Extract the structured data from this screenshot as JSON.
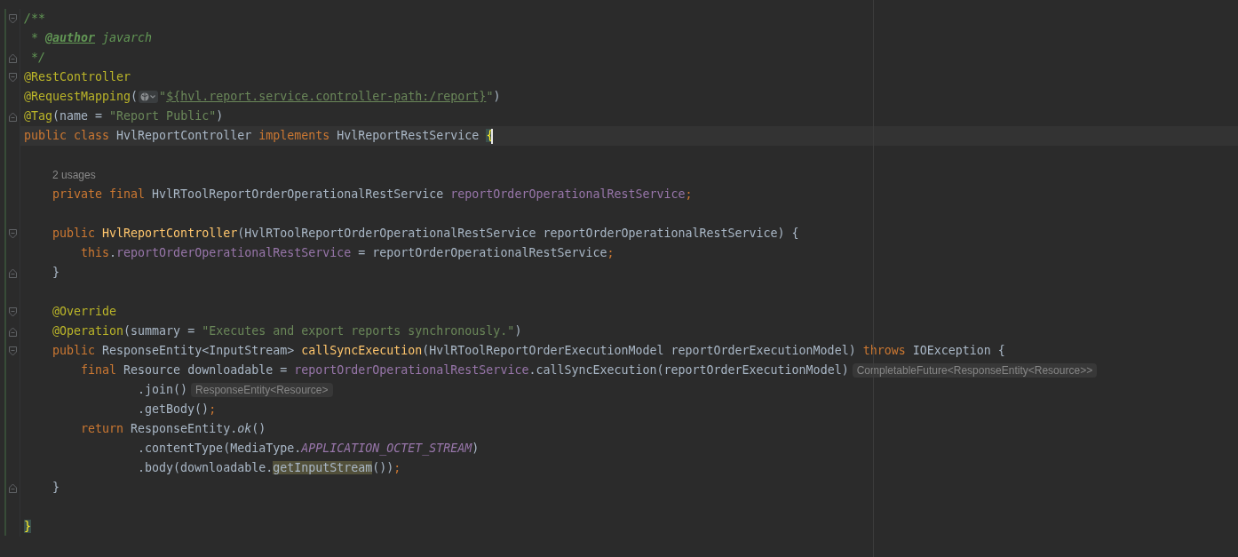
{
  "editor": {
    "lines": [
      {
        "current": false,
        "kind": "fold-start",
        "tokens": [
          {
            "kind": "comment",
            "text": "/**"
          }
        ]
      },
      {
        "current": false,
        "kind": "code",
        "tokens": [
          {
            "kind": "comment",
            "text": " * "
          },
          {
            "kind": "doc-tag",
            "text": "@author"
          },
          {
            "kind": "comment",
            "text": " javarch"
          }
        ]
      },
      {
        "current": false,
        "kind": "fold-end",
        "tokens": [
          {
            "kind": "comment",
            "text": " */"
          }
        ]
      },
      {
        "current": false,
        "kind": "fold-start",
        "tokens": [
          {
            "kind": "annotation",
            "text": "@RestController"
          }
        ]
      },
      {
        "current": false,
        "kind": "code",
        "tokens": [
          {
            "kind": "annotation",
            "text": "@RequestMapping"
          },
          {
            "kind": "plain",
            "text": "("
          },
          {
            "kind": "url-inlay"
          },
          {
            "kind": "string",
            "text": "\""
          },
          {
            "kind": "link-string",
            "text": "${hvl.report.service.controller-path:/report}"
          },
          {
            "kind": "string",
            "text": "\""
          },
          {
            "kind": "plain",
            "text": ")"
          }
        ]
      },
      {
        "current": false,
        "kind": "fold-end",
        "tokens": [
          {
            "kind": "annotation",
            "text": "@Tag"
          },
          {
            "kind": "plain",
            "text": "(name = "
          },
          {
            "kind": "string",
            "text": "\"Report Public\""
          },
          {
            "kind": "plain",
            "text": ")"
          }
        ]
      },
      {
        "current": true,
        "kind": "code",
        "tokens": [
          {
            "kind": "keyword",
            "text": "public class "
          },
          {
            "kind": "plain",
            "text": "HvlReportController "
          },
          {
            "kind": "keyword",
            "text": "implements "
          },
          {
            "kind": "plain",
            "text": "HvlReportRestService "
          },
          {
            "kind": "brace-match",
            "text": "{"
          }
        ]
      },
      {
        "current": false,
        "kind": "code"
      },
      {
        "current": false,
        "kind": "code",
        "tokens": [
          {
            "kind": "indent"
          },
          {
            "kind": "usages-hint",
            "text": "2 usages"
          }
        ]
      },
      {
        "current": false,
        "kind": "code",
        "tokens": [
          {
            "kind": "indent"
          },
          {
            "kind": "keyword",
            "text": "private final "
          },
          {
            "kind": "plain",
            "text": "HvlRToolReportOrderOperationalRestService "
          },
          {
            "kind": "field",
            "text": "reportOrderOperationalRestService"
          },
          {
            "kind": "keyword",
            "text": ";"
          }
        ]
      },
      {
        "current": false,
        "kind": "code"
      },
      {
        "current": false,
        "kind": "fold-start",
        "tokens": [
          {
            "kind": "indent"
          },
          {
            "kind": "keyword",
            "text": "public "
          },
          {
            "kind": "method-decl",
            "text": "HvlReportController"
          },
          {
            "kind": "plain",
            "text": "(HvlRToolReportOrderOperationalRestService reportOrderOperationalRestService) {"
          }
        ]
      },
      {
        "current": false,
        "kind": "code",
        "tokens": [
          {
            "kind": "indent"
          },
          {
            "kind": "indent"
          },
          {
            "kind": "keyword",
            "text": "this"
          },
          {
            "kind": "plain",
            "text": "."
          },
          {
            "kind": "field",
            "text": "reportOrderOperationalRestService"
          },
          {
            "kind": "plain",
            "text": " = reportOrderOperationalRestService"
          },
          {
            "kind": "keyword",
            "text": ";"
          }
        ]
      },
      {
        "current": false,
        "kind": "fold-end",
        "tokens": [
          {
            "kind": "indent"
          },
          {
            "kind": "plain",
            "text": "}"
          }
        ]
      },
      {
        "current": false,
        "kind": "code"
      },
      {
        "current": false,
        "kind": "fold-start",
        "tokens": [
          {
            "kind": "indent"
          },
          {
            "kind": "annotation",
            "text": "@Override"
          }
        ]
      },
      {
        "current": false,
        "kind": "fold-end",
        "tokens": [
          {
            "kind": "indent"
          },
          {
            "kind": "annotation",
            "text": "@Operation"
          },
          {
            "kind": "plain",
            "text": "(summary = "
          },
          {
            "kind": "string",
            "text": "\"Executes and export reports synchronously.\""
          },
          {
            "kind": "plain",
            "text": ")"
          }
        ]
      },
      {
        "current": false,
        "kind": "fold-start",
        "tokens": [
          {
            "kind": "indent"
          },
          {
            "kind": "keyword",
            "text": "public "
          },
          {
            "kind": "plain",
            "text": "ResponseEntity<InputStream> "
          },
          {
            "kind": "method-decl",
            "text": "callSyncExecution"
          },
          {
            "kind": "plain",
            "text": "(HvlRToolReportOrderExecutionModel reportOrderExecutionModel) "
          },
          {
            "kind": "keyword",
            "text": "throws "
          },
          {
            "kind": "plain",
            "text": "IOException {"
          }
        ]
      },
      {
        "current": false,
        "kind": "code",
        "tokens": [
          {
            "kind": "indent"
          },
          {
            "kind": "indent"
          },
          {
            "kind": "keyword",
            "text": "final "
          },
          {
            "kind": "plain",
            "text": "Resource downloadable = "
          },
          {
            "kind": "field",
            "text": "reportOrderOperationalRestService"
          },
          {
            "kind": "plain",
            "text": ".callSyncExecution(reportOrderExecutionModel)"
          },
          {
            "kind": "type-hint",
            "text": "CompletableFuture<ResponseEntity<Resource>>"
          }
        ]
      },
      {
        "current": false,
        "kind": "code",
        "tokens": [
          {
            "kind": "indent"
          },
          {
            "kind": "indent"
          },
          {
            "kind": "indent"
          },
          {
            "kind": "indent"
          },
          {
            "kind": "plain",
            "text": ".join()"
          },
          {
            "kind": "type-hint",
            "text": "ResponseEntity<Resource>"
          }
        ]
      },
      {
        "current": false,
        "kind": "code",
        "tokens": [
          {
            "kind": "indent"
          },
          {
            "kind": "indent"
          },
          {
            "kind": "indent"
          },
          {
            "kind": "indent"
          },
          {
            "kind": "plain",
            "text": ".getBody()"
          },
          {
            "kind": "keyword",
            "text": ";"
          }
        ]
      },
      {
        "current": false,
        "kind": "code",
        "tokens": [
          {
            "kind": "indent"
          },
          {
            "kind": "indent"
          },
          {
            "kind": "keyword",
            "text": "return "
          },
          {
            "kind": "plain",
            "text": "ResponseEntity."
          },
          {
            "kind": "static-method",
            "text": "ok"
          },
          {
            "kind": "plain",
            "text": "()"
          }
        ]
      },
      {
        "current": false,
        "kind": "code",
        "tokens": [
          {
            "kind": "indent"
          },
          {
            "kind": "indent"
          },
          {
            "kind": "indent"
          },
          {
            "kind": "indent"
          },
          {
            "kind": "plain",
            "text": ".contentType(MediaType."
          },
          {
            "kind": "static-field",
            "text": "APPLICATION_OCTET_STREAM"
          },
          {
            "kind": "plain",
            "text": ")"
          }
        ]
      },
      {
        "current": false,
        "kind": "code",
        "tokens": [
          {
            "kind": "indent"
          },
          {
            "kind": "indent"
          },
          {
            "kind": "indent"
          },
          {
            "kind": "indent"
          },
          {
            "kind": "plain",
            "text": ".body(downloadable."
          },
          {
            "kind": "usage-highlight",
            "text": "getInputStream"
          },
          {
            "kind": "plain",
            "text": "())"
          },
          {
            "kind": "keyword",
            "text": ";"
          }
        ]
      },
      {
        "current": false,
        "kind": "fold-end",
        "tokens": [
          {
            "kind": "indent"
          },
          {
            "kind": "plain",
            "text": "}"
          }
        ]
      },
      {
        "current": false,
        "kind": "code"
      },
      {
        "current": false,
        "kind": "code",
        "tokens": [
          {
            "kind": "brace-match",
            "text": "}"
          }
        ]
      }
    ]
  }
}
